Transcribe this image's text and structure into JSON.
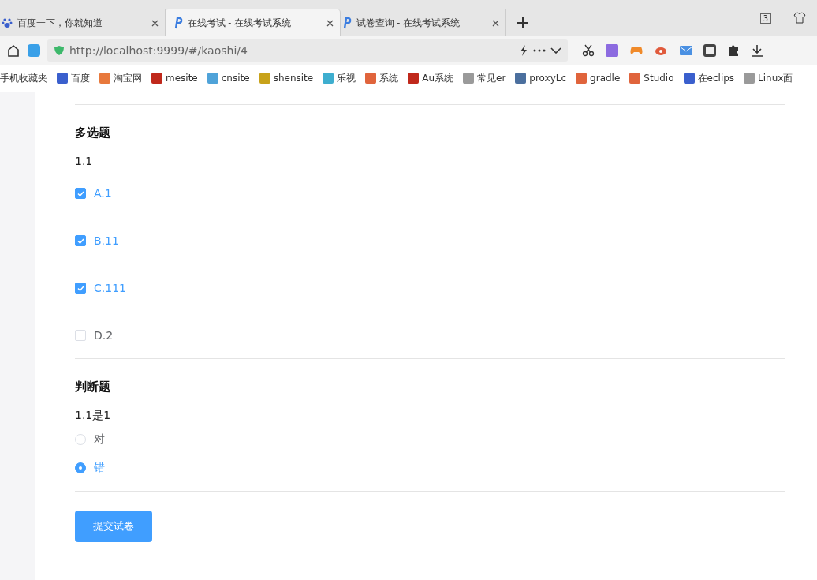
{
  "browser": {
    "tabs": [
      {
        "title": "百度一下，你就知道",
        "kind": "paw",
        "selected": false
      },
      {
        "title": "在线考试 - 在线考试系统",
        "kind": "p",
        "selected": true
      },
      {
        "title": "试卷查询 - 在线考试系统",
        "kind": "p",
        "selected": false
      }
    ],
    "tab_count": "3",
    "url_host": "http://localhost",
    "url_rest": ":9999/#/kaoshi/4",
    "bookmarks": [
      {
        "label": "手机收藏夹"
      },
      {
        "label": "百度",
        "color": "#3a5fcd"
      },
      {
        "label": "淘宝网",
        "color": "#e8793c"
      },
      {
        "label": "mesite",
        "color": "#c0281b"
      },
      {
        "label": "cnsite",
        "color": "#4fa3d9"
      },
      {
        "label": "shensite",
        "color": "#c8a21a"
      },
      {
        "label": "乐视",
        "color": "#3eaecf"
      },
      {
        "label": "系统",
        "color": "#e0643c"
      },
      {
        "label": "Au系统",
        "color": "#c0281b"
      },
      {
        "label": "常见er",
        "color": "#9a9a9a"
      },
      {
        "label": "proxyLc",
        "color": "#4b6f9e"
      },
      {
        "label": "gradle",
        "color": "#e0643c"
      },
      {
        "label": "Studio",
        "color": "#e0643c"
      },
      {
        "label": "在eclips",
        "color": "#3a5fcd"
      },
      {
        "label": "Linux面",
        "color": "#9a9a9a"
      }
    ]
  },
  "exam": {
    "sections": [
      {
        "kind": "multiple",
        "heading": "多选题",
        "question": "1.1",
        "options": [
          {
            "label": "A.1",
            "checked": true
          },
          {
            "label": "B.11",
            "checked": true
          },
          {
            "label": "C.111",
            "checked": true
          },
          {
            "label": "D.2",
            "checked": false
          }
        ]
      },
      {
        "kind": "judge",
        "heading": "判断题",
        "question": "1.1是1",
        "options": [
          {
            "label": "对",
            "selected": false
          },
          {
            "label": "错",
            "selected": true
          }
        ]
      }
    ],
    "submit": "提交试卷"
  }
}
